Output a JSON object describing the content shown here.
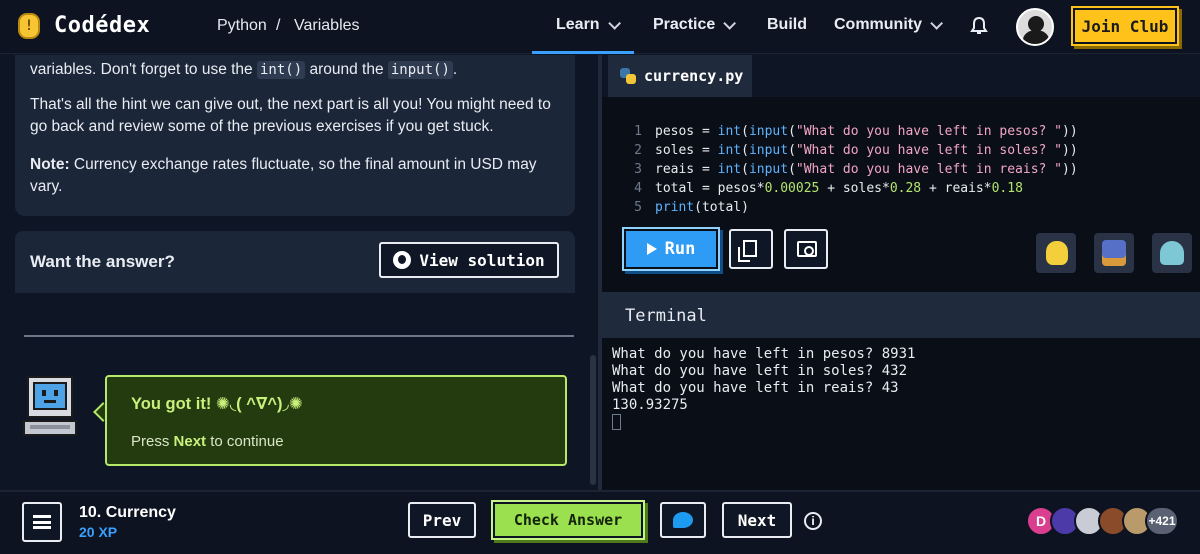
{
  "topnav": {
    "brand": "Codédex",
    "crumb_course": "Python",
    "crumb_sep": "/",
    "crumb_lesson": "Variables",
    "nav": [
      "Learn",
      "Practice",
      "Build",
      "Community"
    ],
    "join_label": "Join Club"
  },
  "hint": {
    "line1_pre": "variables. Don't forget to use the ",
    "code1": "int()",
    "line1_mid": " around the ",
    "code2": "input()",
    "line1_end": ".",
    "para2": "That's all the hint we can give out, the next part is all you! You might need to go back and review some of the previous exercises if you get stuck.",
    "note_label": "Note:",
    "note_text": " Currency exchange rates fluctuate, so the final amount in USD may vary."
  },
  "answer": {
    "label": "Want the answer?",
    "button": "View solution"
  },
  "success": {
    "title": "You got it! ✺◟( ^∇^)◞✺",
    "press": "Press ",
    "next_word": "Next",
    "continue": " to continue"
  },
  "editor": {
    "filename": "currency.py",
    "run_label": "Run",
    "code": [
      {
        "n": "1",
        "a": "pesos = ",
        "fn1": "int",
        "p1": "(",
        "fn2": "input",
        "p2": "(",
        "s": "\"What do you have left in pesos? \"",
        "e": "))"
      },
      {
        "n": "2",
        "a": "soles = ",
        "fn1": "int",
        "p1": "(",
        "fn2": "input",
        "p2": "(",
        "s": "\"What do you have left in soles? \"",
        "e": "))"
      },
      {
        "n": "3",
        "a": "reais = ",
        "fn1": "int",
        "p1": "(",
        "fn2": "input",
        "p2": "(",
        "s": "\"What do you have left in reais? \"",
        "e": "))"
      }
    ],
    "line4": {
      "n": "4",
      "a": "total = pesos*",
      "n1": "0.00025",
      "b": " + soles*",
      "n2": "0.28",
      "c": " + reais*",
      "n3": "0.18"
    },
    "line5": {
      "n": "5",
      "fn": "print",
      "a": "(total)"
    }
  },
  "terminal": {
    "title": "Terminal",
    "lines": [
      "What do you have left in pesos? 8931",
      "What do you have left in soles? 432",
      "What do you have left in reais? 43",
      "130.93275"
    ]
  },
  "bottombar": {
    "lesson": "10. Currency",
    "xp": "20 XP",
    "prev": "Prev",
    "check": "Check Answer",
    "next": "Next",
    "info": "i",
    "avatar_initial": "D",
    "count": "+421"
  },
  "colors": {
    "accent": "#3aa0ff",
    "join": "#ffc21a",
    "check": "#9be14f",
    "success_border": "#b7e86a"
  }
}
